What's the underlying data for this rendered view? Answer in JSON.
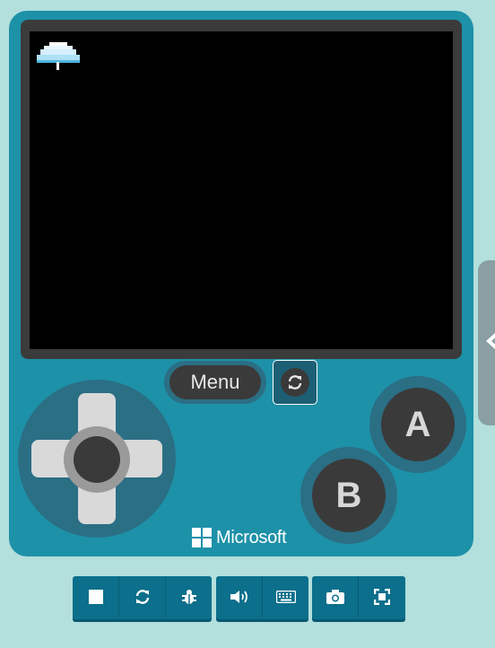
{
  "simulator": {
    "menu_label": "Menu",
    "a_label": "A",
    "b_label": "B",
    "brand_label": "Microsoft",
    "icons": {
      "reset": "refresh-icon",
      "side_tab": "chevron-left-icon",
      "sprite": "umbrella-sprite",
      "brand": "microsoft-logo-icon"
    },
    "colors": {
      "page_background": "#b3dfdd",
      "console": "#1d91a8",
      "screen": "#000000",
      "toolbar": "#0c6f8b"
    }
  },
  "toolbar": {
    "groups": [
      [
        "stop-icon",
        "restart-icon",
        "debug-icon"
      ],
      [
        "mute-icon",
        "keyboard-icon"
      ],
      [
        "screenshot-icon",
        "fullscreen-icon"
      ]
    ]
  }
}
